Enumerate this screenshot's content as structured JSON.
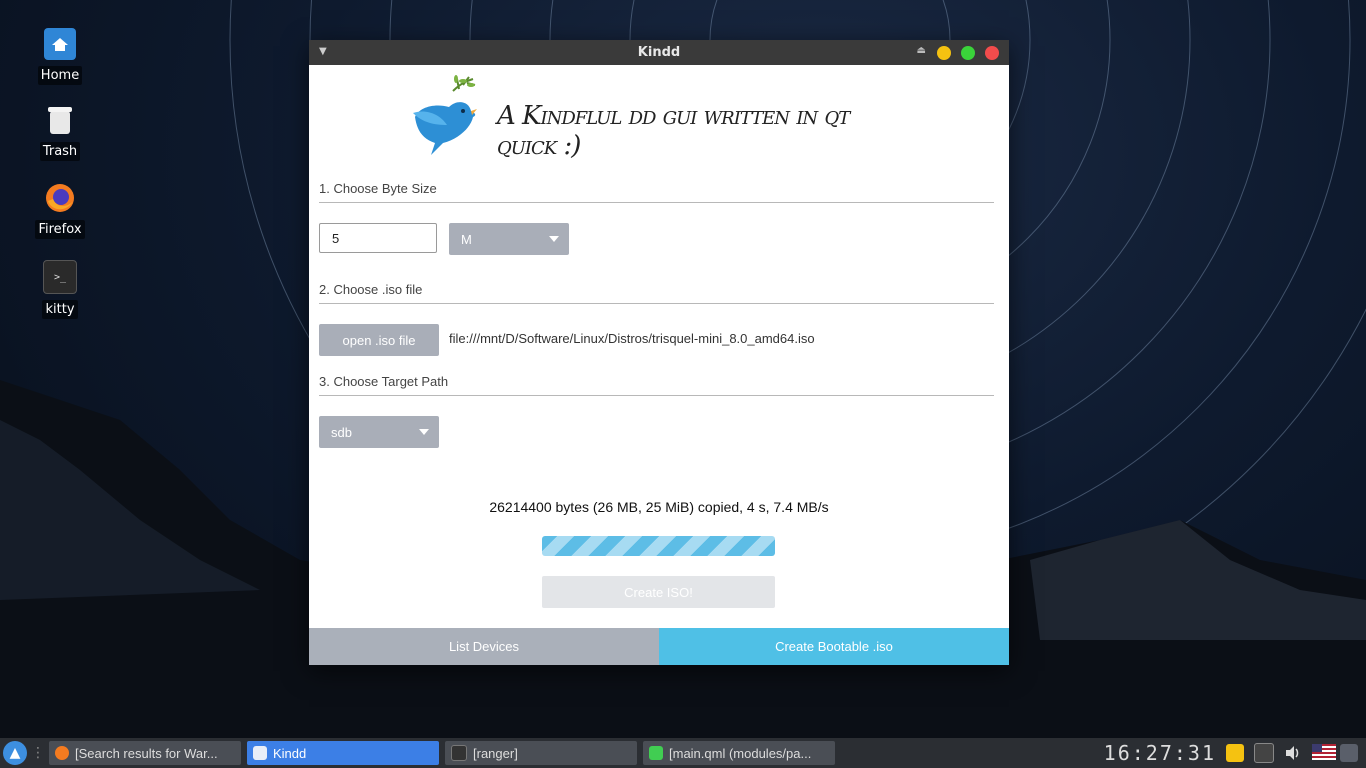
{
  "desktop": {
    "icons": [
      {
        "label": "Home",
        "icon": "folder-home-icon"
      },
      {
        "label": "Trash",
        "icon": "trash-icon"
      },
      {
        "label": "Firefox",
        "icon": "firefox-icon"
      },
      {
        "label": "kitty",
        "icon": "terminal-icon"
      }
    ]
  },
  "window": {
    "title": "Kindd",
    "tagline": "A Kindflul dd gui written in qt quick :)",
    "sections": {
      "byte_size_title": "1. Choose Byte Size",
      "iso_title": "2. Choose .iso file",
      "target_title": "3. Choose Target Path"
    },
    "byte_size_value": "5",
    "byte_unit_selected": "M",
    "open_iso_label": "open .iso file",
    "iso_path": "file:///mnt/D/Software/Linux/Distros/trisquel-mini_8.0_amd64.iso",
    "target_selected": "sdb",
    "status": "26214400 bytes (26 MB, 25 MiB) copied, 4 s, 7.4 MB/s",
    "create_iso_label": "Create ISO!",
    "bottom": {
      "list_devices": "List Devices",
      "create_bootable": "Create Bootable .iso"
    },
    "colors": {
      "accent": "#4fc0e6",
      "grey_button": "#a9aeb8"
    }
  },
  "taskbar": {
    "tasks": [
      {
        "label": "[Search results for War...",
        "icon": "firefox-icon",
        "active": false
      },
      {
        "label": "Kindd",
        "icon": "window-icon",
        "active": true
      },
      {
        "label": "[ranger]",
        "icon": "terminal-icon",
        "active": false
      },
      {
        "label": "[main.qml (modules/pa...",
        "icon": "qt-creator-icon",
        "active": false
      }
    ],
    "clock": "16:27:31"
  }
}
